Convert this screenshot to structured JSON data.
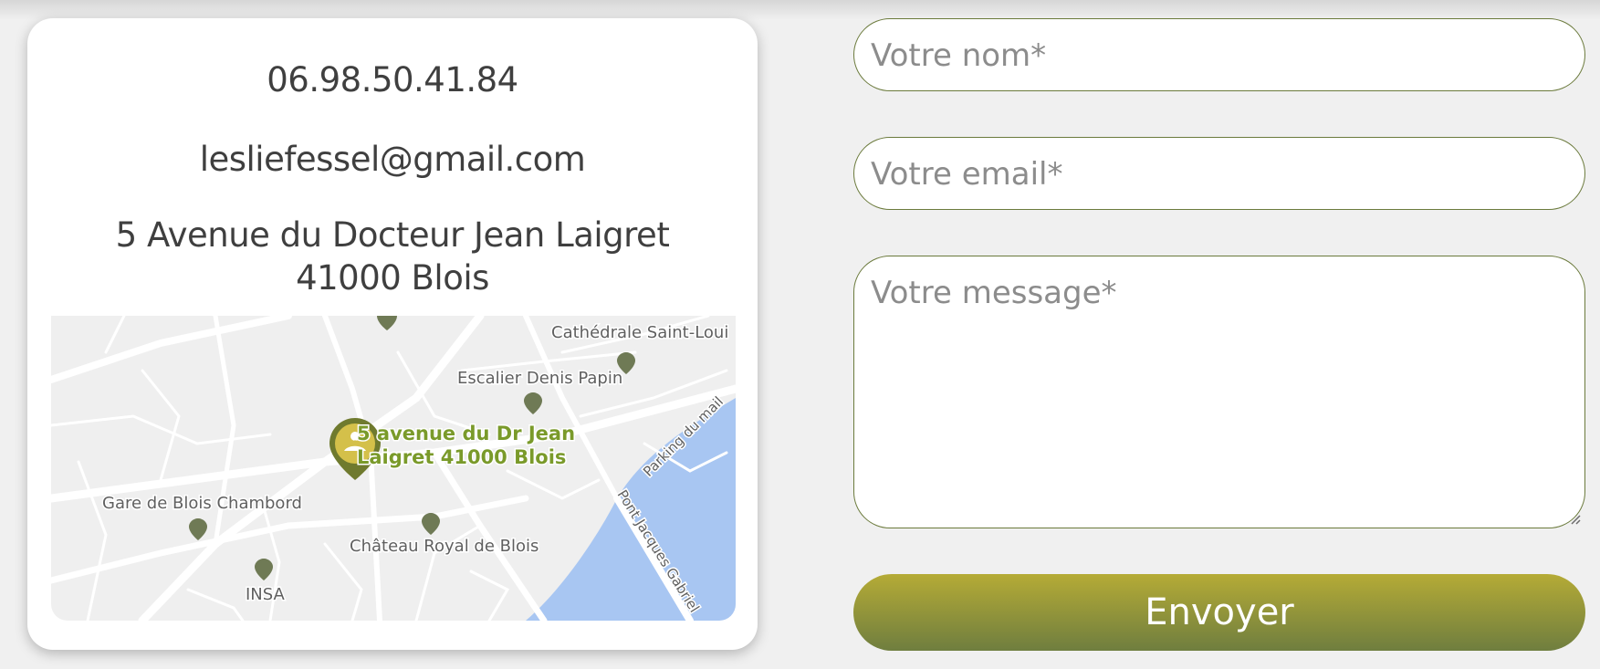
{
  "contact": {
    "phone": "06.98.50.41.84",
    "email": "lesliefessel@gmail.com",
    "address_line1": "5 Avenue du Docteur Jean Laigret",
    "address_line2": "41000 Blois"
  },
  "map": {
    "marker_label_line1": "5 avenue du Dr Jean",
    "marker_label_line2": "Laigret 41000 Blois",
    "places": {
      "cathedrale": "Cathédrale Saint-Loui",
      "escalier": "Escalier Denis Papin",
      "gare": "Gare de Blois Chambord",
      "chateau": "Château Royal de Blois",
      "insa": "INSA"
    },
    "streets": {
      "parking": "Parking du mail",
      "pont": "Pont Jacques Gabriel"
    },
    "colors": {
      "water": "#a8c6f2",
      "road": "#ffffff",
      "land": "#efefef",
      "poi_pin": "#6f7a55",
      "marker": "#6f7a2e",
      "marker_label": "#7a9a2a"
    }
  },
  "form": {
    "name_placeholder": "Votre nom*",
    "email_placeholder": "Votre email*",
    "message_placeholder": "Votre message*",
    "submit_label": "Envoyer"
  },
  "colors": {
    "field_border": "#6b7a3c",
    "button_gradient_top": "#b5ab36",
    "button_gradient_bottom": "#6f7e3f"
  }
}
